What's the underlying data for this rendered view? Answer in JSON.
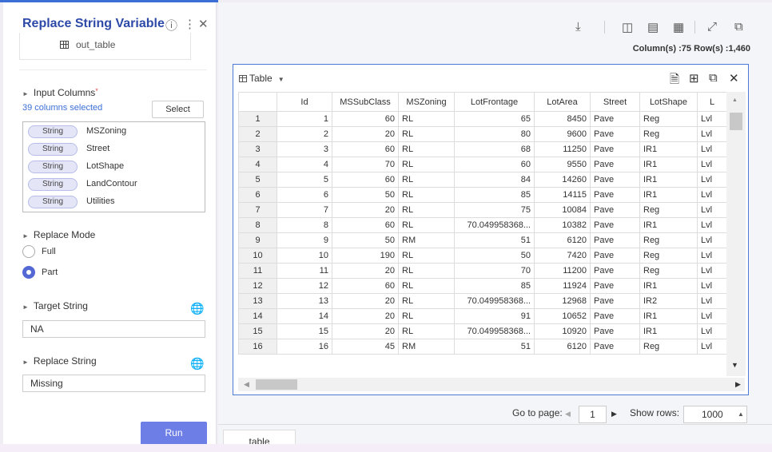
{
  "panel": {
    "title": "Replace String Variable",
    "output_name": "out_table",
    "input_columns": {
      "label": "Input Columns",
      "required_mark": "*",
      "selected_count": "39 columns selected",
      "select_button": "Select",
      "columns": [
        {
          "type": "String",
          "name": "MSZoning"
        },
        {
          "type": "String",
          "name": "Street"
        },
        {
          "type": "String",
          "name": "LotShape"
        },
        {
          "type": "String",
          "name": "LandContour"
        },
        {
          "type": "String",
          "name": "Utilities"
        }
      ]
    },
    "replace_mode": {
      "label": "Replace Mode",
      "options": [
        "Full",
        "Part"
      ],
      "selected": "Part"
    },
    "target_string": {
      "label": "Target String",
      "value": "NA"
    },
    "replace_string": {
      "label": "Replace String",
      "value": "Missing"
    },
    "run_button": "Run"
  },
  "viewer": {
    "info": "Column(s) :75  Row(s) :1,460",
    "table_label": "Table",
    "columns": [
      "",
      "Id",
      "MSSubClass",
      "MSZoning",
      "LotFrontage",
      "LotArea",
      "Street",
      "LotShape",
      "L"
    ],
    "rows": [
      [
        "1",
        "1",
        "60",
        "RL",
        "65",
        "8450",
        "Pave",
        "Reg",
        "Lvl"
      ],
      [
        "2",
        "2",
        "20",
        "RL",
        "80",
        "9600",
        "Pave",
        "Reg",
        "Lvl"
      ],
      [
        "3",
        "3",
        "60",
        "RL",
        "68",
        "11250",
        "Pave",
        "IR1",
        "Lvl"
      ],
      [
        "4",
        "4",
        "70",
        "RL",
        "60",
        "9550",
        "Pave",
        "IR1",
        "Lvl"
      ],
      [
        "5",
        "5",
        "60",
        "RL",
        "84",
        "14260",
        "Pave",
        "IR1",
        "Lvl"
      ],
      [
        "6",
        "6",
        "50",
        "RL",
        "85",
        "14115",
        "Pave",
        "IR1",
        "Lvl"
      ],
      [
        "7",
        "7",
        "20",
        "RL",
        "75",
        "10084",
        "Pave",
        "Reg",
        "Lvl"
      ],
      [
        "8",
        "8",
        "60",
        "RL",
        "70.049958368...",
        "10382",
        "Pave",
        "IR1",
        "Lvl"
      ],
      [
        "9",
        "9",
        "50",
        "RM",
        "51",
        "6120",
        "Pave",
        "Reg",
        "Lvl"
      ],
      [
        "10",
        "10",
        "190",
        "RL",
        "50",
        "7420",
        "Pave",
        "Reg",
        "Lvl"
      ],
      [
        "11",
        "11",
        "20",
        "RL",
        "70",
        "11200",
        "Pave",
        "Reg",
        "Lvl"
      ],
      [
        "12",
        "12",
        "60",
        "RL",
        "85",
        "11924",
        "Pave",
        "IR1",
        "Lvl"
      ],
      [
        "13",
        "13",
        "20",
        "RL",
        "70.049958368...",
        "12968",
        "Pave",
        "IR2",
        "Lvl"
      ],
      [
        "14",
        "14",
        "20",
        "RL",
        "91",
        "10652",
        "Pave",
        "IR1",
        "Lvl"
      ],
      [
        "15",
        "15",
        "20",
        "RL",
        "70.049958368...",
        "10920",
        "Pave",
        "IR1",
        "Lvl"
      ],
      [
        "16",
        "16",
        "45",
        "RM",
        "51",
        "6120",
        "Pave",
        "Reg",
        "Lvl"
      ]
    ],
    "pagination": {
      "goto_label": "Go to page:",
      "page": "1",
      "show_rows_label": "Show rows:",
      "rows_per_page": "1000"
    },
    "tab": "table"
  },
  "icons": {
    "help": "help-icon",
    "more": "more-icon",
    "close": "close-icon",
    "download": "download-icon",
    "globe": "globe-icon"
  },
  "colors": {
    "accent": "#3b6fd6",
    "run": "#6d7ee6",
    "title": "#2d4aa8"
  }
}
